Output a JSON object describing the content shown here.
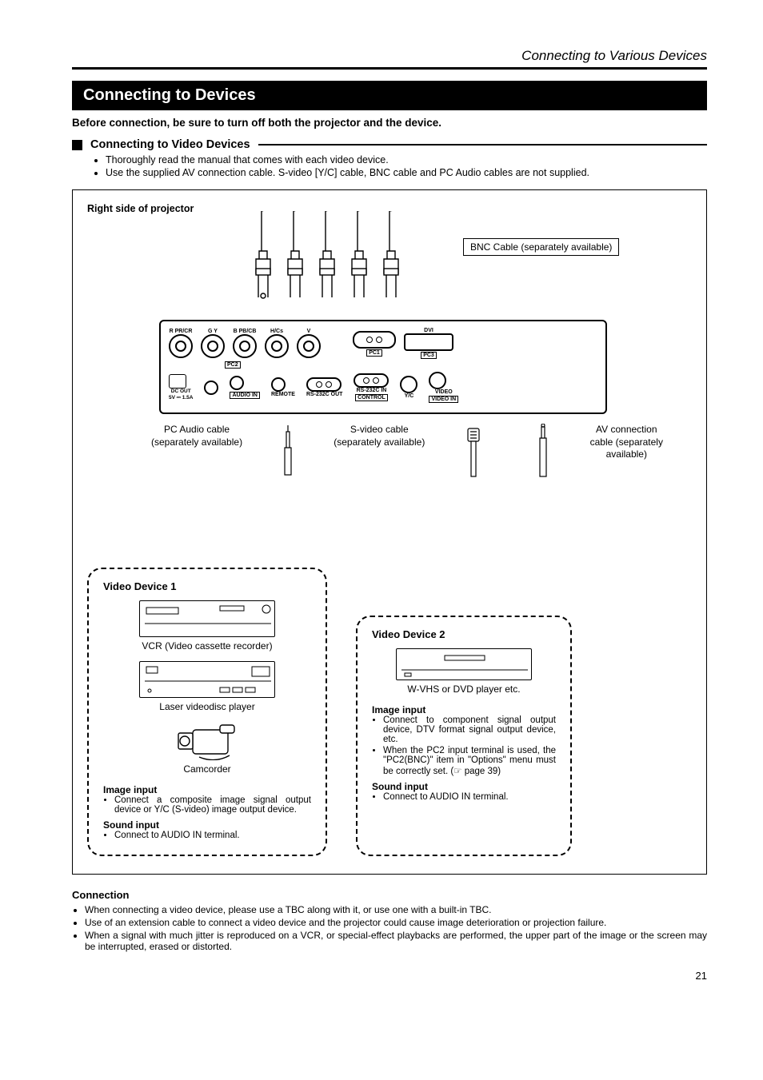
{
  "breadcrumb": "Connecting to Various Devices",
  "title": "Connecting to Devices",
  "intro": "Before connection, be sure to turn off both the projector and the device.",
  "sub1_heading": "Connecting to Video Devices",
  "sub1_bullets": [
    "Thoroughly read the manual that comes with each video device.",
    "Use the supplied AV connection cable. S-video [Y/C] cable, BNC cable and PC Audio cables are not supplied."
  ],
  "diagram": {
    "projector_side_label": "Right side of projector",
    "bnc_callout": "BNC Cable (separately available)",
    "panel": {
      "bnc_labels": [
        "R PR/CR",
        "G Y",
        "B PB/CB",
        "H/Cs",
        "V"
      ],
      "pc1": "PC1",
      "pc2": "PC2",
      "pc3": "PC3",
      "dvi": "DVI",
      "dc_out_1": "DC OUT",
      "dc_out_2": "5V ⎓ 1.5A",
      "audio_in": "AUDIO IN",
      "remote": "REMOTE",
      "rs_out": "RS-232C OUT",
      "rs_in": "RS-232C IN",
      "control": "CONTROL",
      "yc": "Y/C",
      "video": "VIDEO",
      "video_in": "VIDEO IN"
    },
    "callouts": {
      "pc_audio_1": "PC Audio cable",
      "pc_audio_2": "(separately available)",
      "svideo_1": "S-video cable",
      "svideo_2": "(separately available)",
      "av_1": "AV connection",
      "av_2": "cable (separately",
      "av_3": "available)"
    },
    "device1": {
      "title": "Video Device 1",
      "vcr_caption": "VCR (Video cassette recorder)",
      "ld_caption": "Laser videodisc player",
      "cam_caption": "Camcorder",
      "image_head": "Image input",
      "image_b1": "Connect a composite image signal output device or Y/C (S-video) image output device.",
      "sound_head": "Sound input",
      "sound_b1": "Connect to AUDIO IN terminal."
    },
    "device2": {
      "title": "Video Device 2",
      "wvhs_caption": "W-VHS or DVD player etc.",
      "image_head": "Image input",
      "image_b1": "Connect to component signal output device, DTV format signal output device, etc.",
      "image_b2": "When the PC2 input terminal is used, the \"PC2(BNC)\" item in \"Options\" menu must be correctly set. (☞ page 39)",
      "sound_head": "Sound input",
      "sound_b1": "Connect to AUDIO IN terminal."
    }
  },
  "connection": {
    "heading": "Connection",
    "bullets": [
      "When connecting a video device, please use a TBC along with it, or use one with a built-in TBC.",
      "Use of an extension cable to connect a video device and the projector could cause image deterioration or projection failure.",
      "When a signal with much jitter is reproduced on a VCR, or special-effect playbacks are performed, the upper part of the image or the screen may be interrupted, erased or distorted."
    ]
  },
  "page_number": "21"
}
